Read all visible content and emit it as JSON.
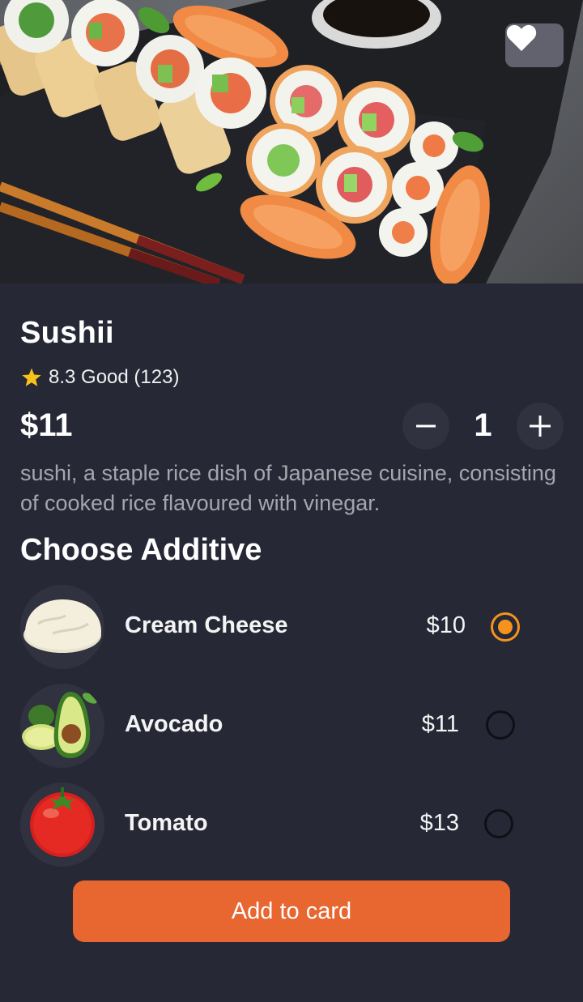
{
  "product": {
    "name": "Sushii",
    "rating": "8.3 Good (123)",
    "price": "$11",
    "quantity": "1",
    "description": "sushi, a staple rice dish of Japanese cuisine, consisting of cooked rice flavoured with vinegar."
  },
  "additives": {
    "title": "Choose Additive",
    "items": [
      {
        "name": "Cream Cheese",
        "price": "$10",
        "selected": true
      },
      {
        "name": "Avocado",
        "price": "$11",
        "selected": false
      },
      {
        "name": "Tomato",
        "price": "$13",
        "selected": false
      }
    ]
  },
  "actions": {
    "add_label": "Add to card"
  },
  "colors": {
    "background": "#262836",
    "accent": "#e8662f",
    "radio_selected": "#f5931e",
    "star": "#f7c21a"
  },
  "icons": [
    "heart-icon",
    "star-icon",
    "minus-icon",
    "plus-icon"
  ]
}
